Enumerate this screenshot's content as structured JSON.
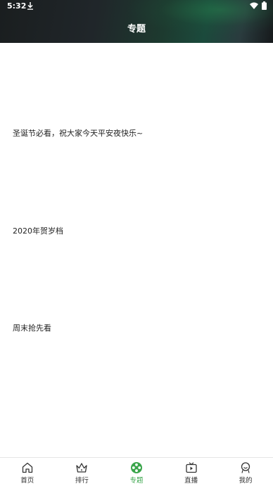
{
  "status_bar": {
    "time": "5:32"
  },
  "header": {
    "title": "专题"
  },
  "topics": [
    {
      "label": "圣诞节必看，祝大家今天平安夜快乐~"
    },
    {
      "label": "2020年贺岁档"
    },
    {
      "label": "周末抢先看"
    }
  ],
  "bottom_nav": {
    "items": [
      {
        "label": "首页",
        "icon": "home-icon",
        "active": false
      },
      {
        "label": "排行",
        "icon": "crown-icon",
        "active": false
      },
      {
        "label": "专题",
        "icon": "film-reel-icon",
        "active": true
      },
      {
        "label": "直播",
        "icon": "tv-icon",
        "active": false
      },
      {
        "label": "我的",
        "icon": "profile-icon",
        "active": false
      }
    ],
    "active_color": "#3aa54b",
    "inactive_color": "#333333"
  }
}
